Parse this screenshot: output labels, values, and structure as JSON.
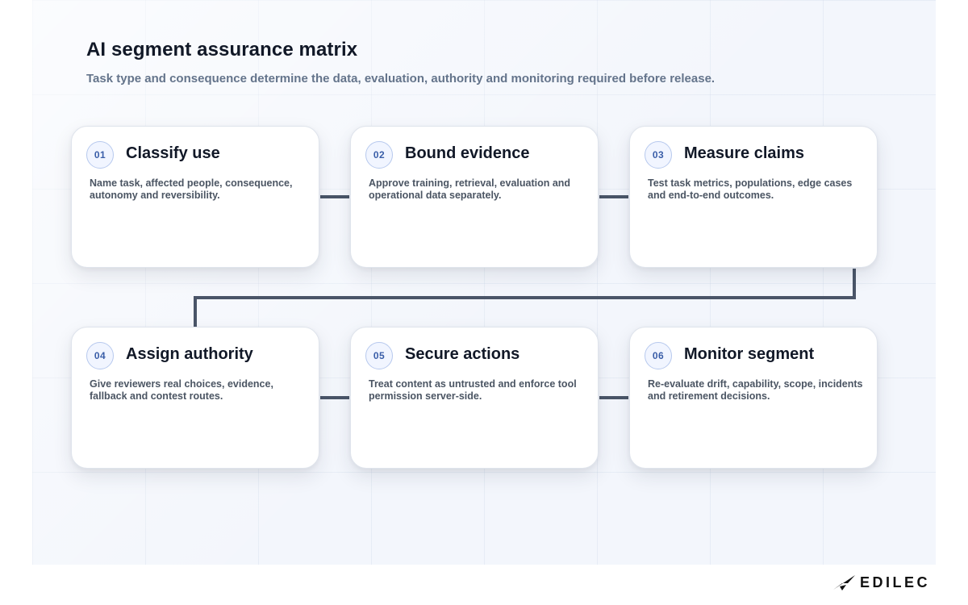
{
  "title": "AI segment assurance matrix",
  "subtitle": "Task type and consequence determine the data, evaluation, authority and monitoring required before release.",
  "steps": [
    {
      "number": "01",
      "title": "Classify use",
      "description": "Name task, affected people, consequence, autonomy and reversibility."
    },
    {
      "number": "02",
      "title": "Bound evidence",
      "description": "Approve training, retrieval, evaluation and operational data separately."
    },
    {
      "number": "03",
      "title": "Measure claims",
      "description": "Test task metrics, populations, edge cases and end-to-end outcomes."
    },
    {
      "number": "04",
      "title": "Assign authority",
      "description": "Give reviewers real choices, evidence, fallback and contest routes."
    },
    {
      "number": "05",
      "title": "Secure actions",
      "description": "Treat content as untrusted and enforce tool permission server-side."
    },
    {
      "number": "06",
      "title": "Monitor segment",
      "description": "Re-evaluate drift, capability, scope, incidents and retirement decisions."
    }
  ],
  "brand": {
    "name": "EDILEC",
    "logo_icon": "edilec-logo-icon"
  },
  "colors": {
    "connector": "#4a5568",
    "accent": "#3a5ea8",
    "panel": "#f3f6fc"
  }
}
